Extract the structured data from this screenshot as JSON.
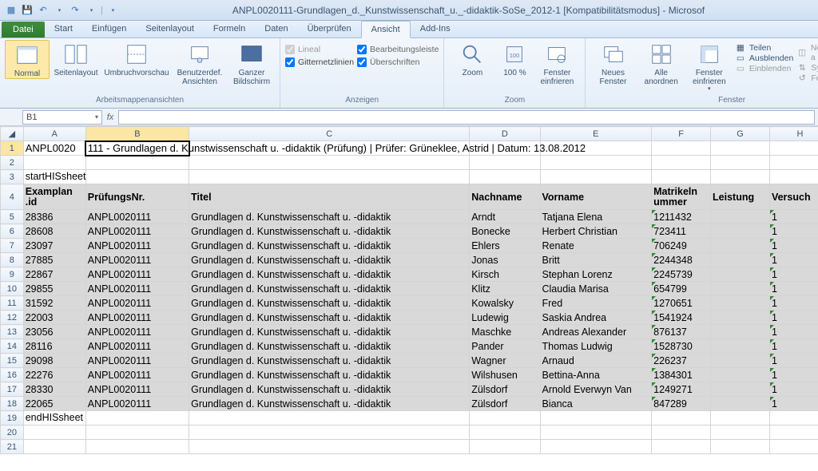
{
  "window": {
    "title": "ANPL0020111-Grundlagen_d._Kunstwissenschaft_u._-didaktik-SoSe_2012-1  [Kompatibilitätsmodus] - Microsof"
  },
  "tabs": {
    "file": "Datei",
    "items": [
      "Start",
      "Einfügen",
      "Seitenlayout",
      "Formeln",
      "Daten",
      "Überprüfen",
      "Ansicht",
      "Add-Ins"
    ],
    "active": "Ansicht"
  },
  "ribbon": {
    "group_views": {
      "label": "Arbeitsmappenansichten",
      "normal": "Normal",
      "layout": "Seitenlayout",
      "umbruch": "Umbruchvorschau",
      "custom": "Benutzerdef. Ansichten",
      "full": "Ganzer Bildschirm"
    },
    "group_show": {
      "label": "Anzeigen",
      "lineal": "Lineal",
      "gridlines": "Gitternetzlinien",
      "formula": "Bearbeitungsleiste",
      "headings": "Überschriften"
    },
    "group_zoom": {
      "label": "Zoom",
      "zoom": "Zoom",
      "hundred": "100 %",
      "fit": "Fenster einfrieren"
    },
    "group_window": {
      "label": "Fenster",
      "newwin": "Neues Fenster",
      "arrange": "Alle anordnen",
      "freeze": "Fenster einfrieren",
      "split": "Teilen",
      "hide": "Ausblenden",
      "unhide": "Einblenden",
      "side": "Nebeneinander a",
      "sync": "Synchroner Bildl",
      "pos": "Fensterposition"
    }
  },
  "namebox": "B1",
  "cols": [
    "A",
    "B",
    "C",
    "D",
    "E",
    "F",
    "G",
    "H"
  ],
  "row1_text": "ANPL0020111 - Grundlagen d. Kunstwissenschaft u. -didaktik (Prüfung) | Prüfer: Grüneklee, Astrid | Datum: 13.08.2012",
  "row1_A": "ANPL0020",
  "row1_B": "111 - Grundlagen d.",
  "row3": "startHISsheet",
  "row4": {
    "A": "Examplan.id",
    "B": "PrüfungsNr.",
    "C": "Titel",
    "D": "Nachname",
    "E": "Vorname",
    "F": "Matrikelnummer",
    "G": "Leistung",
    "H": "Versuch"
  },
  "data": [
    {
      "r": 5,
      "A": "28386",
      "B": "ANPL0020111",
      "C": "Grundlagen d. Kunstwissenschaft u. -didaktik",
      "D": "Arndt",
      "E": "Tatjana Elena",
      "F": "1211432",
      "H": "1"
    },
    {
      "r": 6,
      "A": "28608",
      "B": "ANPL0020111",
      "C": "Grundlagen d. Kunstwissenschaft u. -didaktik",
      "D": "Bonecke",
      "E": "Herbert Christian",
      "F": "723411",
      "H": "1"
    },
    {
      "r": 7,
      "A": "23097",
      "B": "ANPL0020111",
      "C": "Grundlagen d. Kunstwissenschaft u. -didaktik",
      "D": "Ehlers",
      "E": "Renate",
      "F": "706249",
      "H": "1"
    },
    {
      "r": 8,
      "A": "27885",
      "B": "ANPL0020111",
      "C": "Grundlagen d. Kunstwissenschaft u. -didaktik",
      "D": "Jonas",
      "E": "Britt",
      "F": "2244348",
      "H": "1"
    },
    {
      "r": 9,
      "A": "22867",
      "B": "ANPL0020111",
      "C": "Grundlagen d. Kunstwissenschaft u. -didaktik",
      "D": "Kirsch",
      "E": "Stephan Lorenz",
      "F": "2245739",
      "H": "1"
    },
    {
      "r": 10,
      "A": "29855",
      "B": "ANPL0020111",
      "C": "Grundlagen d. Kunstwissenschaft u. -didaktik",
      "D": "Klitz",
      "E": "Claudia Marisa",
      "F": "654799",
      "H": "1"
    },
    {
      "r": 11,
      "A": "31592",
      "B": "ANPL0020111",
      "C": "Grundlagen d. Kunstwissenschaft u. -didaktik",
      "D": "Kowalsky",
      "E": "Fred",
      "F": "1270651",
      "H": "1"
    },
    {
      "r": 12,
      "A": "22003",
      "B": "ANPL0020111",
      "C": "Grundlagen d. Kunstwissenschaft u. -didaktik",
      "D": "Ludewig",
      "E": "Saskia Andrea",
      "F": "1541924",
      "H": "1"
    },
    {
      "r": 13,
      "A": "23056",
      "B": "ANPL0020111",
      "C": "Grundlagen d. Kunstwissenschaft u. -didaktik",
      "D": "Maschke",
      "E": "Andreas Alexander",
      "F": "876137",
      "H": "1"
    },
    {
      "r": 14,
      "A": "28116",
      "B": "ANPL0020111",
      "C": "Grundlagen d. Kunstwissenschaft u. -didaktik",
      "D": "Pander",
      "E": "Thomas Ludwig",
      "F": "1528730",
      "H": "1"
    },
    {
      "r": 15,
      "A": "29098",
      "B": "ANPL0020111",
      "C": "Grundlagen d. Kunstwissenschaft u. -didaktik",
      "D": "Wagner",
      "E": "Arnaud",
      "F": "226237",
      "H": "1"
    },
    {
      "r": 16,
      "A": "22276",
      "B": "ANPL0020111",
      "C": "Grundlagen d. Kunstwissenschaft u. -didaktik",
      "D": "Wilshusen",
      "E": "Bettina-Anna",
      "F": "1384301",
      "H": "1"
    },
    {
      "r": 17,
      "A": "28330",
      "B": "ANPL0020111",
      "C": "Grundlagen d. Kunstwissenschaft u. -didaktik",
      "D": "Zülsdorf",
      "E": "Arnold Everwyn Van",
      "F": "1249271",
      "H": "1"
    },
    {
      "r": 18,
      "A": "22065",
      "B": "ANPL0020111",
      "C": "Grundlagen d. Kunstwissenschaft u. -didaktik",
      "D": "Zülsdorf",
      "E": "Bianca",
      "F": "847289",
      "H": "1"
    }
  ],
  "row19": "endHISsheet"
}
